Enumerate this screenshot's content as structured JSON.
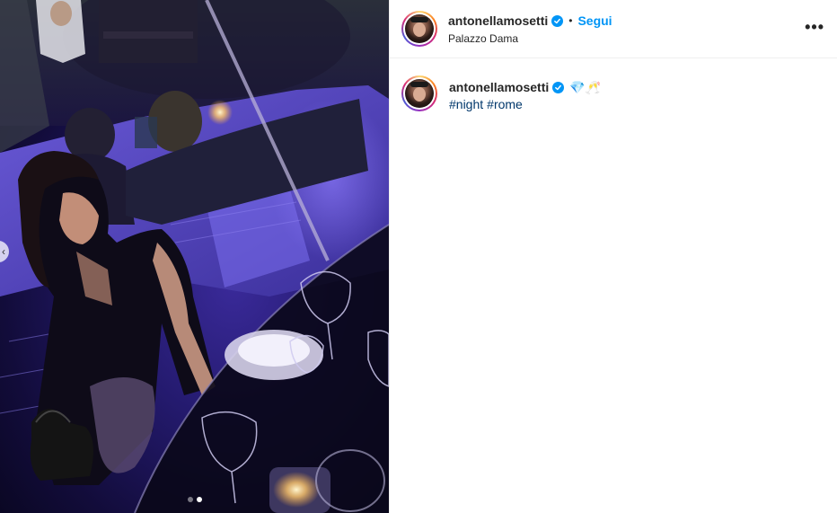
{
  "post": {
    "username": "antonellamosetti",
    "verified": true,
    "separator": "•",
    "follow_label": "Segui",
    "location": "Palazzo Dama",
    "more_icon": "more-options-icon",
    "more_glyph": "•••"
  },
  "caption": {
    "username": "antonellamosetti",
    "emojis": "💎🥂",
    "hashtags": [
      "#night",
      "#rome"
    ]
  },
  "media": {
    "prev_glyph": "‹",
    "dots": {
      "count": 2,
      "active_index": 1
    }
  },
  "colors": {
    "accent": "#0095f6",
    "hashtag": "#00376b",
    "text": "#262626",
    "divider": "#efefef"
  }
}
